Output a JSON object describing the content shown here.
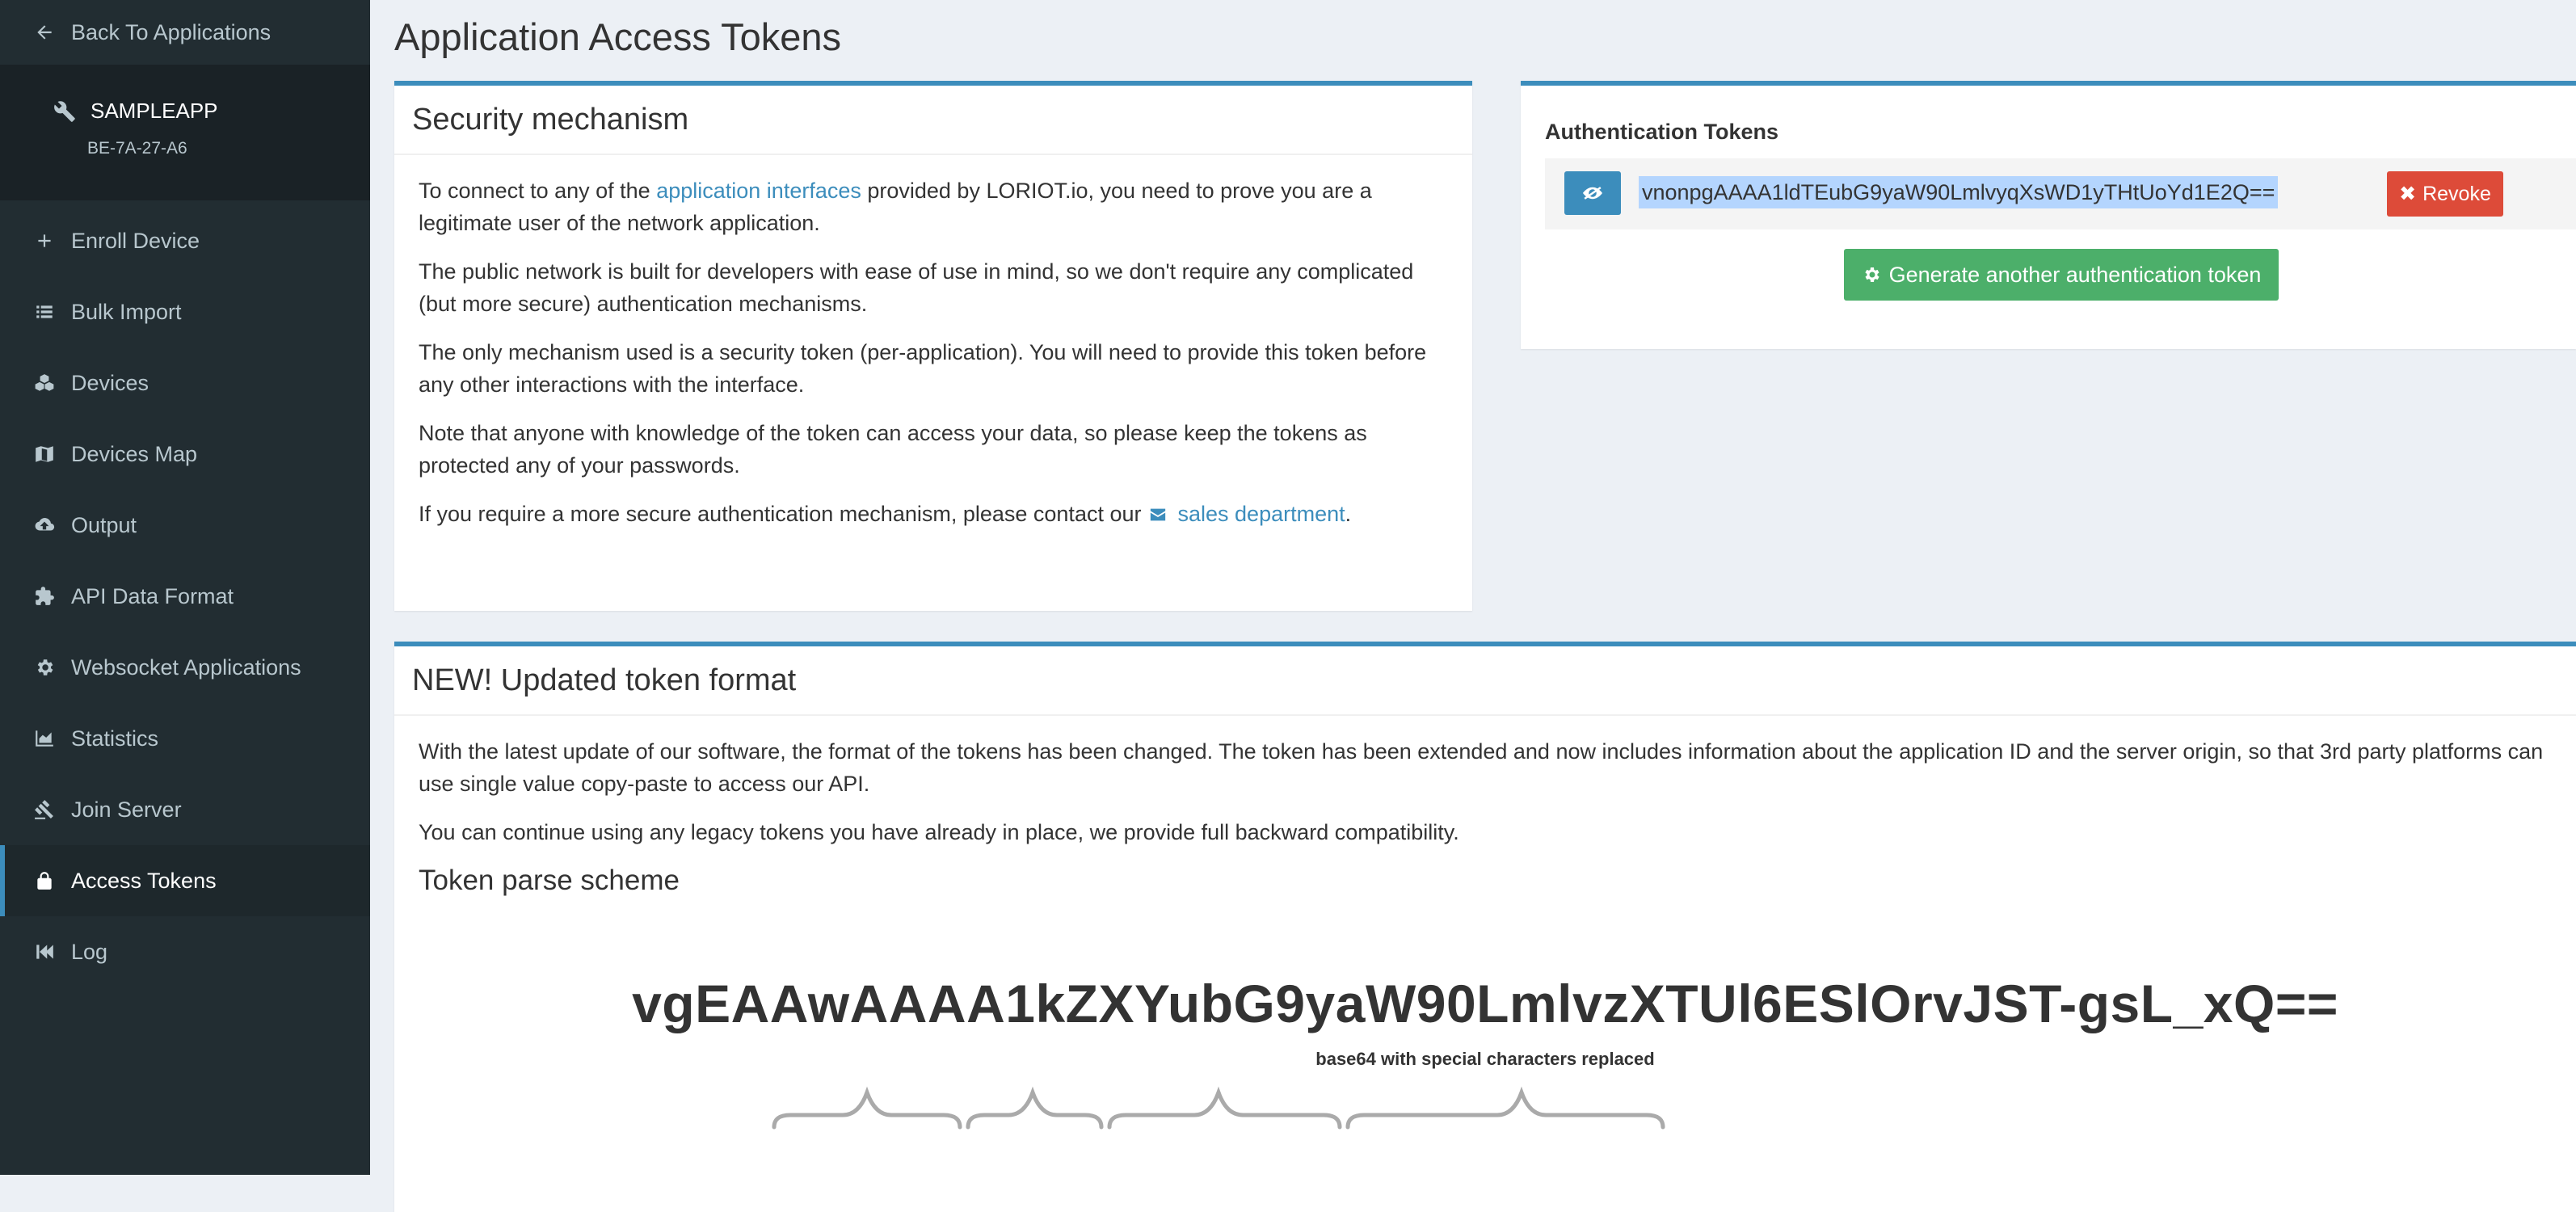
{
  "sidebar": {
    "back_label": "Back To Applications",
    "app_name": "SAMPLEAPP",
    "app_id": "BE-7A-27-A6",
    "items": [
      {
        "label": "Enroll Device",
        "icon": "plus-icon"
      },
      {
        "label": "Bulk Import",
        "icon": "list-icon"
      },
      {
        "label": "Devices",
        "icon": "cubes-icon"
      },
      {
        "label": "Devices Map",
        "icon": "map-icon"
      },
      {
        "label": "Output",
        "icon": "cloud-upload-icon"
      },
      {
        "label": "API Data Format",
        "icon": "puzzle-icon"
      },
      {
        "label": "Websocket Applications",
        "icon": "gear-icon"
      },
      {
        "label": "Statistics",
        "icon": "area-chart-icon"
      },
      {
        "label": "Join Server",
        "icon": "gavel-icon"
      },
      {
        "label": "Access Tokens",
        "icon": "lock-icon",
        "active": true
      },
      {
        "label": "Log",
        "icon": "fast-backward-icon"
      }
    ]
  },
  "page": {
    "title": "Application Access Tokens"
  },
  "security": {
    "header": "Security mechanism",
    "p1_before": "To connect to any of the ",
    "p1_link": "application interfaces",
    "p1_after": " provided by LORIOT.io, you need to prove you are a legitimate user of the network application.",
    "p2": "The public network is built for developers with ease of use in mind, so we don't require any complicated (but more secure) authentication mechanisms.",
    "p3": "The only mechanism used is a security token (per-application). You will need to provide this token before any other interactions with the interface.",
    "p4": "Note that anyone with knowledge of the token can access your data, so please keep the tokens as protected any of your passwords.",
    "p5_before": "If you require a more secure authentication mechanism, please contact our ",
    "p5_link": "sales department",
    "p5_after": "."
  },
  "tokens": {
    "title": "Authentication Tokens",
    "token_value": "vnonpgAAAA1ldTEubG9yaW90LmlvyqXsWD1yTHtUoYd1E2Q==",
    "revoke_label": "Revoke",
    "generate_label": "Generate another authentication token"
  },
  "new_format": {
    "header": "NEW! Updated token format",
    "p1": "With the latest update of our software, the format of the tokens has been changed. The token has been extended and now includes information about the application ID and the server origin, so that 3rd party platforms can use single value copy-paste to access our API.",
    "p2": "You can continue using any legacy tokens you have already in place, we provide full backward compatibility.",
    "scheme_heading": "Token parse scheme",
    "scheme_token": "vgEAAwAAAA1kZXYubG9yaW90LmlvzXTUl6ESlOrvJST-gsL_xQ==",
    "scheme_caption": "base64 with special characters replaced"
  },
  "colors": {
    "sidebar_bg": "#222d32",
    "accent": "#3c8dbc",
    "revoke": "#dd4b39",
    "generate": "#4caf6a"
  }
}
